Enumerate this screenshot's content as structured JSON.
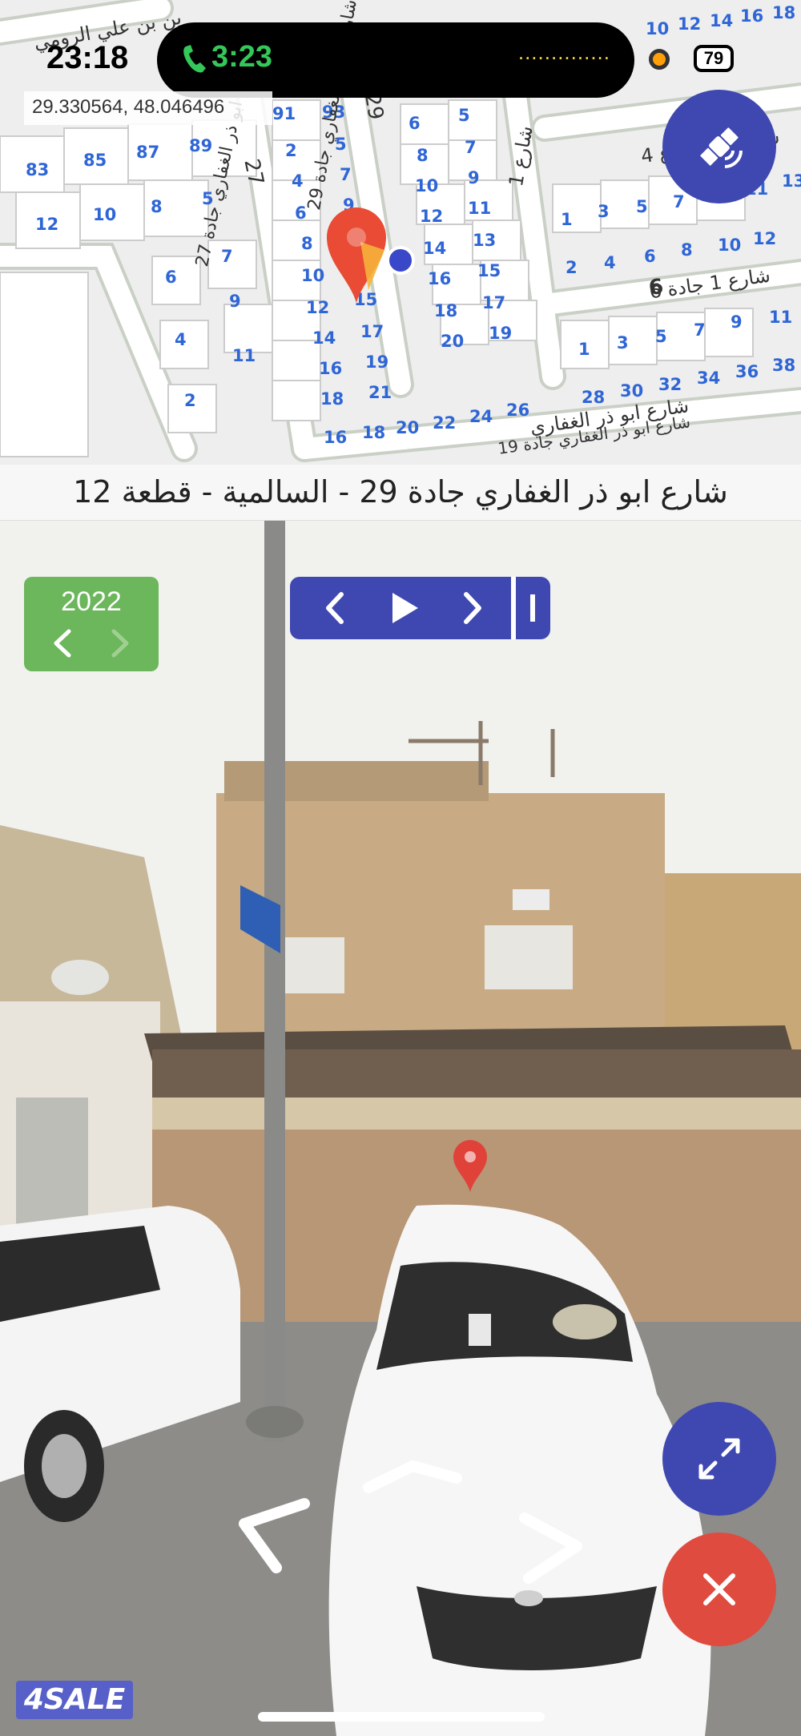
{
  "status_bar": {
    "time": "23:18",
    "call_duration": "3:23",
    "call_indicator": "..............",
    "battery": "79"
  },
  "map": {
    "coordinates": "29.330564, 48.046496",
    "streets": {
      "street_29": "شارع ابو ذر الغفاري جادة 29",
      "street_27": "شارع ابو ذر الغفاري جادة 27",
      "street_1": "شارع 1",
      "street_1_jada6": "شارع 1 جادة 6",
      "street_4": "شارع 4",
      "street_19": "شارع ابو ذر الغفاري جادة 19",
      "street_bottom_right": "شارع ابو ذر الغفاري",
      "street_top": "ين بن علي الرومي",
      "street_top_right": "شارع",
      "number_29": "29",
      "number_27": "27",
      "number_6": "6",
      "number_15": "15"
    },
    "lots": [
      "91",
      "93",
      "6",
      "5",
      "83",
      "85",
      "87",
      "89",
      "2",
      "5",
      "8",
      "7",
      "12",
      "10",
      "8",
      "5",
      "4",
      "7",
      "10",
      "9",
      "6",
      "9",
      "12",
      "11",
      "8",
      "11",
      "14",
      "13",
      "10",
      "16",
      "15",
      "12",
      "15",
      "18",
      "17",
      "14",
      "17",
      "20",
      "19",
      "16",
      "19",
      "18",
      "21",
      "16",
      "18",
      "20",
      "22",
      "24",
      "26",
      "7",
      "9",
      "6",
      "11",
      "4",
      "2",
      "1",
      "3",
      "5",
      "7",
      "9",
      "11",
      "13",
      "2",
      "4",
      "6",
      "8",
      "10",
      "12",
      "1",
      "3",
      "5",
      "7",
      "9",
      "11",
      "28",
      "30",
      "32",
      "34",
      "36",
      "38",
      "10",
      "12",
      "14",
      "16",
      "18"
    ]
  },
  "address": "شارع ابو ذر الغفاري جادة 29 - السالمية - قطعة 12",
  "street_view": {
    "year": "2022"
  },
  "icons": {
    "call": "phone-icon",
    "satellite": "satellite-icon",
    "pin": "map-pin-icon",
    "expand": "expand-icon",
    "close": "close-icon"
  },
  "branding": {
    "logo_text": "4SALE"
  },
  "colors": {
    "accent_blue": "#3f48b0",
    "year_green": "#6cb65c",
    "close_red": "#e04b3f",
    "lot_number_blue": "#2f66d6"
  }
}
